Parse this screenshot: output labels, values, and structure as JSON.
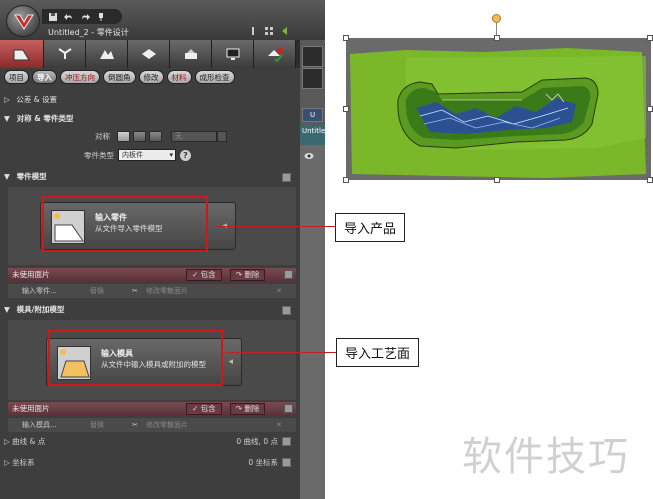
{
  "window": {
    "doc_title": "Untitled_2 - 零件设计",
    "qa_icons": [
      "save-icon",
      "undo-icon",
      "redo-icon",
      "pin-icon"
    ]
  },
  "workflow": {
    "steps": [
      "import-part-icon",
      "parting-icon",
      "surface-icon",
      "mold-icon",
      "core-icon",
      "screen-icon",
      "check-icon"
    ]
  },
  "side": {
    "tab_label": "U",
    "tab2_label": "Untitle"
  },
  "tabs": [
    {
      "label": "项目",
      "style": "normal"
    },
    {
      "label": "导入",
      "style": "active"
    },
    {
      "label": "冲压方向",
      "style": "warn"
    },
    {
      "label": "倒圆角",
      "style": "normal"
    },
    {
      "label": "修改",
      "style": "normal"
    },
    {
      "label": "材料",
      "style": "warn"
    },
    {
      "label": "成形检查",
      "style": "normal"
    }
  ],
  "sections": {
    "tolerance": {
      "arrow": "▷",
      "label": "公差 & 设置"
    },
    "symmetry": {
      "arrow": "▼",
      "label": "对称 & 零件类型"
    },
    "part": {
      "arrow": "▼",
      "label": "零件模型"
    },
    "mold": {
      "arrow": "▼",
      "label": "模具/附加模型"
    }
  },
  "symmetry": {
    "sym_label": "对称",
    "dropdown_value": "无",
    "part_type_label": "零件类型",
    "part_type_value": "内板件",
    "help": "?"
  },
  "import_part": {
    "title": "输入零件",
    "subtitle": "从文件导入零件模型"
  },
  "import_mold": {
    "title": "输入模具",
    "subtitle": "从文件中输入模具或附加的模型"
  },
  "unused": {
    "label": "未使用面片",
    "include": "包含",
    "delete": "删除"
  },
  "toolrow": {
    "part_input": "输入零件...",
    "mold_input": "输入模具...",
    "replace": "替换",
    "scatter": "修改零散面片"
  },
  "rows": {
    "curves_label": "曲线 & 点",
    "curves_count": "0 曲线, 0 点",
    "coords_label": "坐标系",
    "coords_count": "0 坐标系"
  },
  "annotations": {
    "import_product": "导入产品",
    "import_process_face": "导入工艺面"
  },
  "watermark": "软件技巧",
  "colors": {
    "accent_red": "#d01818",
    "die_face_green": "#7ab82a",
    "part_blue": "#2a4aa8"
  }
}
